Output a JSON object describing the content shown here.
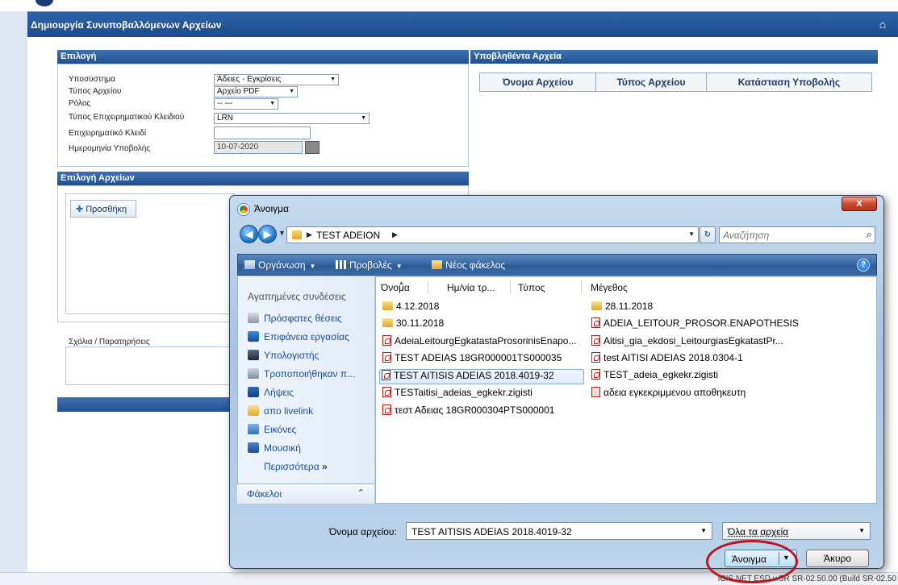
{
  "app": {
    "page_title": "Δημιουργία Συνυποβαλλόμενων Αρχείων",
    "home_icon": "home-icon",
    "help_icon": "help-icon"
  },
  "selection_panel": {
    "title": "Επιλογή",
    "subsystem_label": "Υποσύστημα",
    "subsystem_value": "Άδειες - Εγκρίσεις",
    "file_type_label": "Τύπος Αρχείου",
    "file_type_value": "Αρχείο PDF",
    "role_label": "Ρόλος",
    "role_value": "-- ---",
    "key_type_label": "Τύπος Επιχειρηματικού Κλειδιού",
    "key_type_value": "LRN",
    "business_key_label": "Επιχειρηματικό Κλειδί",
    "business_key_value": "",
    "submission_date_label": "Ημερομηνία Υποβολής",
    "submission_date_value": "10-07-2020"
  },
  "submitted_panel": {
    "title": "Υποβληθέντα Αρχεία",
    "columns": [
      "Όνομα Αρχείου",
      "Τύπος Αρχείου",
      "Κατάσταση Υποβολής"
    ]
  },
  "files_panel": {
    "title": "Επιλογή Αρχείων",
    "add_button": "Προσθήκη"
  },
  "comments_label": "Σχόλια / Παρατηρήσεις",
  "status_bar": {
    "build": "ICIS.NET ESD v.SR SR-02.50.00 (Build SR-02.50"
  },
  "dialog": {
    "title": "Άνοιγμα",
    "close": "X",
    "path": "TEST ADEION",
    "search_placeholder": "Αναζήτηση",
    "toolbar": {
      "organize": "Οργάνωση",
      "views": "Προβολές",
      "new_folder": "Νέος φάκελος"
    },
    "favorites_heading": "Αγαπημένες συνδέσεις",
    "favorites": [
      {
        "label": "Πρόσφατες θέσεις",
        "icon": "recent-places-icon"
      },
      {
        "label": "Επιφάνεια εργασίας",
        "icon": "desktop-icon"
      },
      {
        "label": "Υπολογιστής",
        "icon": "computer-icon"
      },
      {
        "label": "Τροποποιήθηκαν π...",
        "icon": "recently-changed-icon"
      },
      {
        "label": "Λήψεις",
        "icon": "downloads-icon"
      },
      {
        "label": "απο livelink",
        "icon": "folder-icon"
      },
      {
        "label": "Εικόνες",
        "icon": "pictures-icon"
      },
      {
        "label": "Μουσική",
        "icon": "music-icon"
      }
    ],
    "more": "Περισσότερα",
    "folders_label": "Φάκελοι",
    "columns": [
      "Όνομα",
      "Ημ/νία τρ...",
      "Τύπος",
      "Μέγεθος"
    ],
    "files_left": [
      {
        "name": "4.12.2018",
        "icon": "folder"
      },
      {
        "name": "30.11.2018",
        "icon": "folder"
      },
      {
        "name": "AdeiaLeitourgEgkatastaProsorinisEnapo...",
        "icon": "pdf"
      },
      {
        "name": "TEST ADEIAS 18GR000001TS000035",
        "icon": "pdf"
      },
      {
        "name": "TEST AITISIS ADEIAS 2018.4019-32",
        "icon": "pdf"
      },
      {
        "name": "TESTaitisi_adeias_egkekr.zigisti",
        "icon": "pdf"
      },
      {
        "name": "τεστ Αδειας 18GR000304PTS000001",
        "icon": "pdf"
      }
    ],
    "files_right": [
      {
        "name": "28.11.2018",
        "icon": "folder"
      },
      {
        "name": "ADEIA_LEITOUR_PROSOR.ENAPOTHESIS",
        "icon": "pdf"
      },
      {
        "name": "Aitisi_gia_ekdosi_LeitourgiasEgkatastPr...",
        "icon": "pdf"
      },
      {
        "name": "test AITISI ADEIAS 2018.0304-1",
        "icon": "pdf"
      },
      {
        "name": "TEST_adeia_egkekr.zigisti",
        "icon": "pdf"
      },
      {
        "name": "αδεια εγκεκριμμενου αποθηκευτη",
        "icon": "doc"
      }
    ],
    "filename_label": "Όνομα αρχείου:",
    "filename_value": "TEST AITISIS ADEIAS 2018.4019-32",
    "filetype_value": "Όλα τα αρχεία",
    "open_button": "Άνοιγμα",
    "cancel_button": "Άκυρο"
  },
  "colors": {
    "header_blue": "#1c4b8d",
    "highlight_ring": "#b8151f"
  }
}
